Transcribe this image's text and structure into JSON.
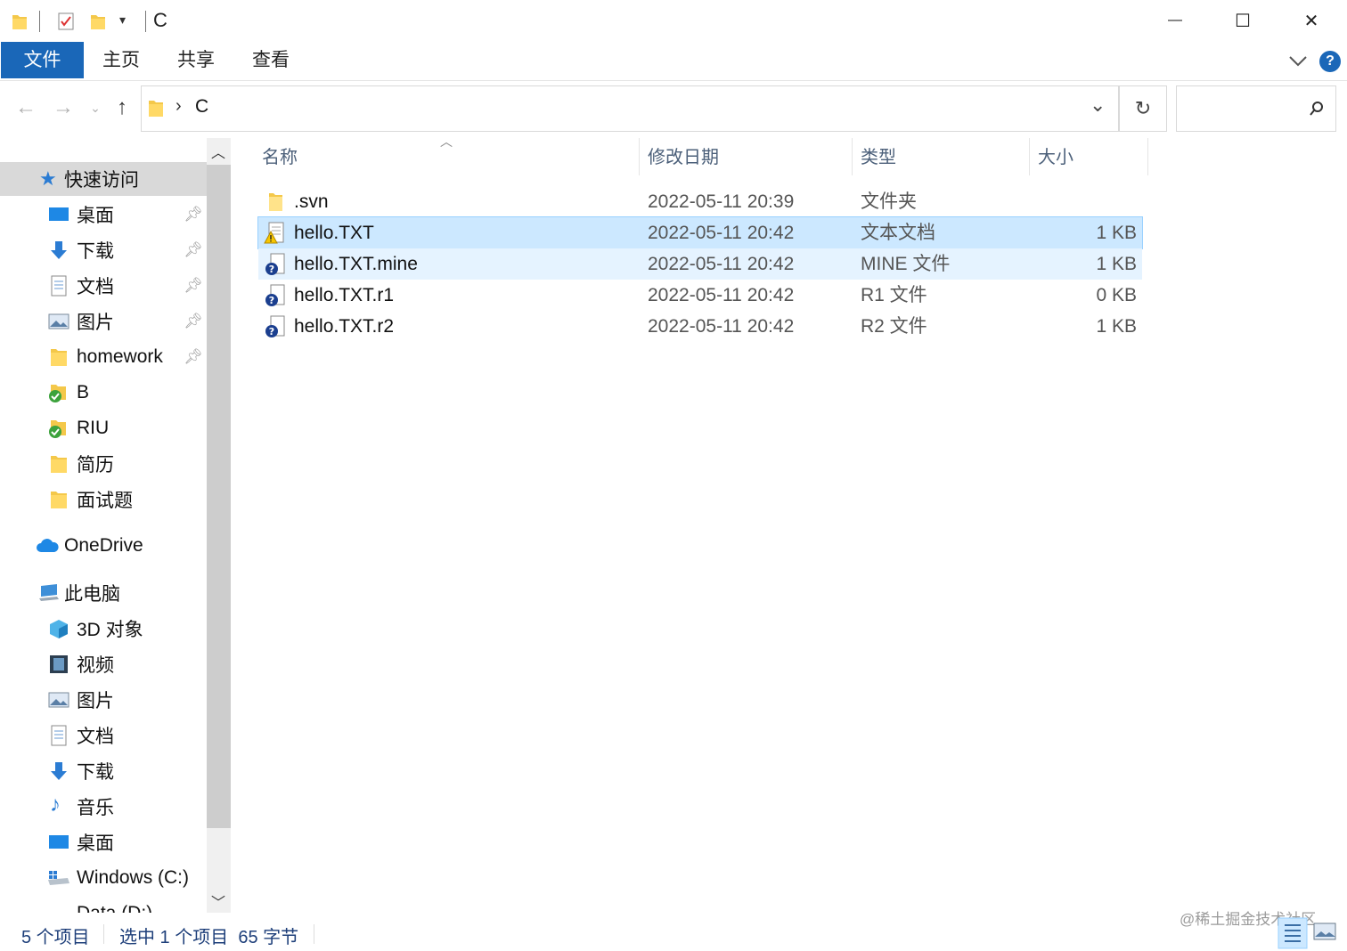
{
  "window": {
    "title": "C",
    "controls": {
      "minimize": "—",
      "maximize": "☐",
      "close": "✕"
    }
  },
  "ribbon": {
    "tabs": [
      "文件",
      "主页",
      "共享",
      "查看"
    ],
    "help": "?"
  },
  "address": {
    "path_separator": "›",
    "path": "C",
    "dropdown": "⌄",
    "refresh": "↻",
    "search_placeholder": "",
    "search_icon": "search-icon"
  },
  "nav": {
    "quick_access": {
      "label": "快速访问",
      "items": [
        {
          "label": "桌面",
          "icon": "desktop-icon",
          "pinned": true
        },
        {
          "label": "下载",
          "icon": "download-icon",
          "pinned": true
        },
        {
          "label": "文档",
          "icon": "document-icon",
          "pinned": true
        },
        {
          "label": "图片",
          "icon": "picture-icon",
          "pinned": true
        },
        {
          "label": "homework",
          "icon": "folder-icon",
          "pinned": true
        },
        {
          "label": "B",
          "icon": "svn-ok-folder-icon",
          "pinned": false
        },
        {
          "label": "RIU",
          "icon": "svn-ok-folder-icon",
          "pinned": false
        },
        {
          "label": "简历",
          "icon": "folder-icon",
          "pinned": false
        },
        {
          "label": "面试题",
          "icon": "folder-icon",
          "pinned": false
        }
      ]
    },
    "onedrive": {
      "label": "OneDrive"
    },
    "this_pc": {
      "label": "此电脑",
      "items": [
        {
          "label": "3D 对象",
          "icon": "3d-objects-icon"
        },
        {
          "label": "视频",
          "icon": "video-icon"
        },
        {
          "label": "图片",
          "icon": "picture-icon"
        },
        {
          "label": "文档",
          "icon": "document-icon"
        },
        {
          "label": "下载",
          "icon": "download-icon"
        },
        {
          "label": "音乐",
          "icon": "music-icon"
        },
        {
          "label": "桌面",
          "icon": "desktop-icon"
        },
        {
          "label": "Windows (C:)",
          "icon": "drive-icon"
        },
        {
          "label": "Data (D:)",
          "icon": "drive-icon"
        }
      ]
    }
  },
  "filelist": {
    "columns": [
      "名称",
      "修改日期",
      "类型",
      "大小"
    ],
    "rows": [
      {
        "name": ".svn",
        "date": "2022-05-11 20:39",
        "type": "文件夹",
        "size": "",
        "icon": "folder-icon",
        "state": "normal"
      },
      {
        "name": "hello.TXT",
        "date": "2022-05-11 20:42",
        "type": "文本文档",
        "size": "1 KB",
        "icon": "svn-conflict-file-icon",
        "state": "selected"
      },
      {
        "name": "hello.TXT.mine",
        "date": "2022-05-11 20:42",
        "type": "MINE 文件",
        "size": "1 KB",
        "icon": "svn-unversioned-file-icon",
        "state": "hover"
      },
      {
        "name": "hello.TXT.r1",
        "date": "2022-05-11 20:42",
        "type": "R1 文件",
        "size": "0 KB",
        "icon": "svn-unversioned-file-icon",
        "state": "normal"
      },
      {
        "name": "hello.TXT.r2",
        "date": "2022-05-11 20:42",
        "type": "R2 文件",
        "size": "1 KB",
        "icon": "svn-unversioned-file-icon",
        "state": "normal"
      }
    ]
  },
  "status": {
    "item_count": "5 个项目",
    "selection": "选中 1 个项目  65 字节"
  },
  "watermark": "@稀土掘金技术社区",
  "colors": {
    "accent": "#1a67b8",
    "selected_bg": "#cce8ff",
    "hover_bg": "#e5f3ff",
    "header_text": "#4c607a"
  }
}
